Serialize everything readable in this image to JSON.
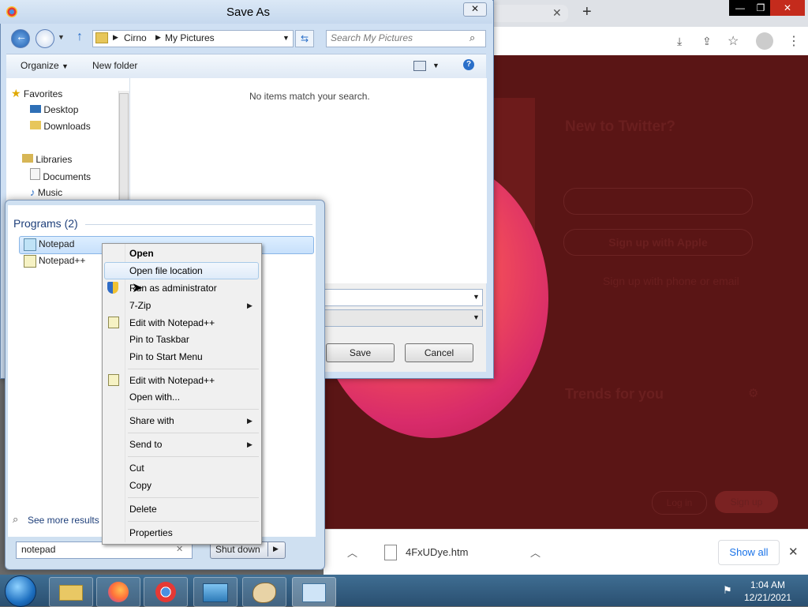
{
  "browser": {
    "window_controls": [
      "—",
      "❐",
      "✕"
    ],
    "new_tab_label": "+",
    "download_file": "4FxUDye.htm",
    "show_all_label": "Show all",
    "twitter": {
      "new_to_twitter": "New to Twitter?",
      "apple_signup": "Sign up with Apple",
      "phone_email_signup": "Sign up with phone or email",
      "trends": "Trends for you",
      "login": "Log in",
      "signup": "Sign up"
    }
  },
  "save_dialog": {
    "title": "Save As",
    "close": "✕",
    "breadcrumb": [
      "Cirno",
      "My Pictures"
    ],
    "search_placeholder": "Search My Pictures",
    "toolbar": {
      "organize": "Organize",
      "new_folder": "New folder"
    },
    "empty_message": "No items match your search.",
    "nav": {
      "favorites": "Favorites",
      "desktop": "Desktop",
      "downloads": "Downloads",
      "libraries": "Libraries",
      "documents": "Documents",
      "music": "Music"
    },
    "save_label": "Save",
    "cancel_label": "Cancel"
  },
  "start_menu": {
    "programs_header": "Programs (2)",
    "programs": [
      "Notepad",
      "Notepad++"
    ],
    "see_more": "See more results",
    "search_value": "notepad",
    "clear": "✕",
    "shutdown_label": "Shut down"
  },
  "context_menu": {
    "open": "Open",
    "open_file_location": "Open file location",
    "run_as_admin": "Run as administrator",
    "seven_zip": "7-Zip",
    "edit_notepadpp_1": "Edit with Notepad++",
    "pin_taskbar": "Pin to Taskbar",
    "pin_start": "Pin to Start Menu",
    "edit_notepadpp_2": "Edit with Notepad++",
    "open_with": "Open with...",
    "share_with": "Share with",
    "send_to": "Send to",
    "cut": "Cut",
    "copy": "Copy",
    "delete": "Delete",
    "properties": "Properties"
  },
  "taskbar": {
    "time": "1:04 AM",
    "date": "12/21/2021"
  }
}
